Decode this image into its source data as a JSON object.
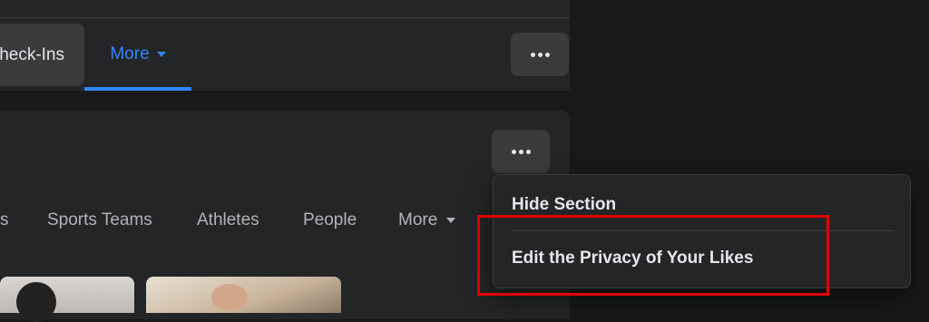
{
  "profile_tabs": {
    "checkins_label": "heck-Ins",
    "more_label": "More",
    "more_color": "#2d88ff",
    "overflow_icon": "more-horizontal-icon"
  },
  "likes_section": {
    "overflow_icon": "more-horizontal-icon",
    "filters": [
      {
        "label": "s"
      },
      {
        "label": "Sports Teams"
      },
      {
        "label": "Athletes"
      },
      {
        "label": "People"
      },
      {
        "label": "More"
      }
    ]
  },
  "section_menu": {
    "items": [
      {
        "label": "Hide Section"
      },
      {
        "label": "Edit the Privacy of Your Likes"
      }
    ],
    "highlight_color": "#e00000"
  }
}
